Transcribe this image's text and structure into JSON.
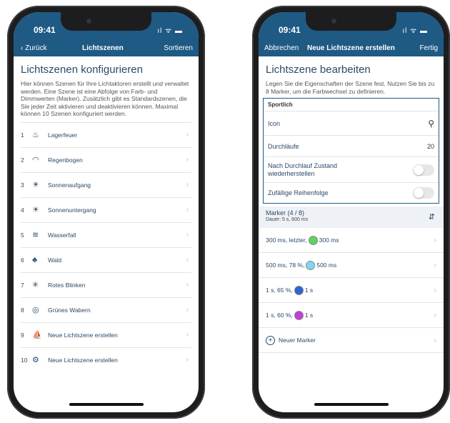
{
  "left": {
    "status": {
      "time": "09:41",
      "icons": "ıl ᯤ ▬"
    },
    "nav": {
      "back": "Zurück",
      "title": "Lichtszenen",
      "action": "Sortieren"
    },
    "heading": "Lichtszenen konfigurieren",
    "description": "Hier können Szenen für Ihre Lichtaktoren erstellt und verwaltet werden. Eine Szene ist eine Abfolge von Farb- und Dimmwerten (Marker). Zusätzlich gibt es Standardszenen, die Sie jeder Zeit aktivieren und deaktivieren können. Maximal können 10 Szenen konfiguriert werden.",
    "items": [
      {
        "num": "1",
        "icon": "campfire-icon",
        "glyph": "♨",
        "label": "Lagerfeuer"
      },
      {
        "num": "2",
        "icon": "rainbow-icon",
        "glyph": "◠",
        "label": "Regenbogen"
      },
      {
        "num": "3",
        "icon": "sunrise-icon",
        "glyph": "☀",
        "label": "Sonnenaufgang"
      },
      {
        "num": "4",
        "icon": "sunset-icon",
        "glyph": "☀",
        "label": "Sonnenuntergang"
      },
      {
        "num": "5",
        "icon": "waterfall-icon",
        "glyph": "≋",
        "label": "Wasserfall"
      },
      {
        "num": "6",
        "icon": "forest-icon",
        "glyph": "♣",
        "label": "Wald"
      },
      {
        "num": "7",
        "icon": "blinking-light-icon",
        "glyph": "✳",
        "label": "Rotes Blinken"
      },
      {
        "num": "8",
        "icon": "waves-icon",
        "glyph": "◎",
        "label": "Grünes Wabern"
      },
      {
        "num": "9",
        "icon": "surf-icon",
        "glyph": "⛵",
        "label": "Neue Lichtszene erstellen"
      },
      {
        "num": "10",
        "icon": "bicycle-icon",
        "glyph": "⚙",
        "label": "Neue Lichtszene erstellen"
      }
    ]
  },
  "right": {
    "status": {
      "time": "09:41",
      "icons": "ıl ᯤ ▬"
    },
    "nav": {
      "cancel": "Abbrechen",
      "title": "Neue Lichtszene erstellen",
      "done": "Fertig"
    },
    "heading": "Lichtszene bearbeiten",
    "description": "Legen Sie die Eigenschaften der Szene fest. Nutzen Sie bis zu 8 Marker, um die Farbwechsel zu definieren.",
    "scene_name": "Sportlich",
    "props": {
      "icon_label": "Icon",
      "icon_glyph": "⚲",
      "cycles_label": "Durchläufe",
      "cycles_value": "20",
      "restore_label": "Nach Durchlauf Zustand wiederherstellen",
      "restore_on": false,
      "random_label": "Zufällige Reihenfolge",
      "random_on": false
    },
    "markers": {
      "title": "Marker (4 / 8)",
      "subtitle": "Dauer: 5 s, 600 ms",
      "rows": [
        {
          "pre": "300 ms, letzter,",
          "color": "#5fd35f",
          "post": "300 ms"
        },
        {
          "pre": "500 ms, 78 %,",
          "color": "#7fd6f0",
          "post": "500 ms"
        },
        {
          "pre": "1 s, 65 %,",
          "color": "#2f63d6",
          "post": "1 s"
        },
        {
          "pre": "1 s, 60 %,",
          "color": "#c43fd6",
          "post": "1 s"
        }
      ],
      "add_label": "Neuer Marker"
    }
  },
  "colors": {
    "nav": "#1f5a85",
    "text": "#2b4a68"
  }
}
